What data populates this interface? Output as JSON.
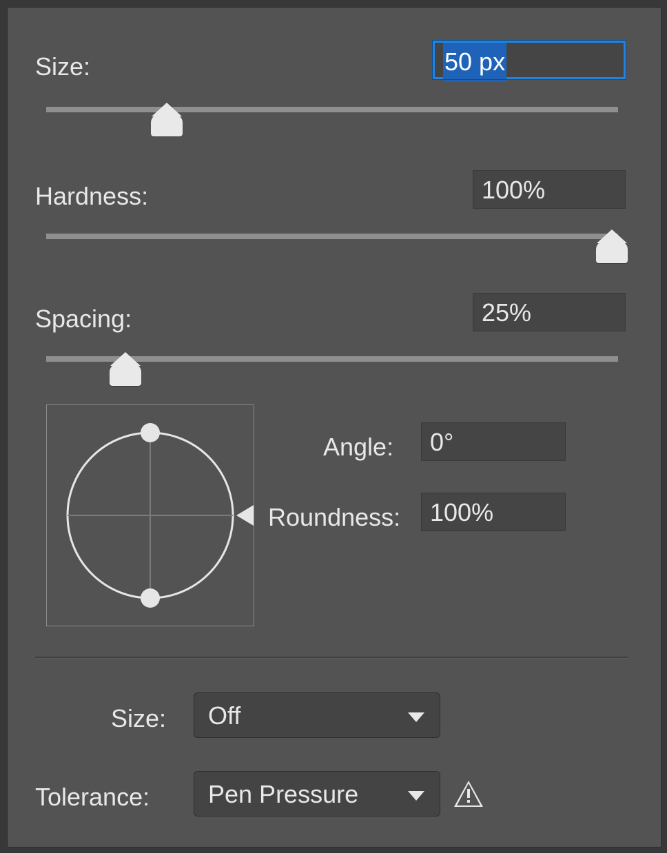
{
  "size": {
    "label": "Size:",
    "value": "50 px",
    "slider_pct": 20
  },
  "hardness": {
    "label": "Hardness:",
    "value": "100%",
    "slider_pct": 100
  },
  "spacing": {
    "label": "Spacing:",
    "value": "25%",
    "slider_pct": 13
  },
  "angle": {
    "label": "Angle:",
    "value": "0°"
  },
  "roundness": {
    "label": "Roundness:",
    "value": "100%"
  },
  "divider": true,
  "size_dyn": {
    "label": "Size:",
    "value": "Off"
  },
  "tolerance": {
    "label": "Tolerance:",
    "value": "Pen Pressure"
  },
  "warning_present": true
}
